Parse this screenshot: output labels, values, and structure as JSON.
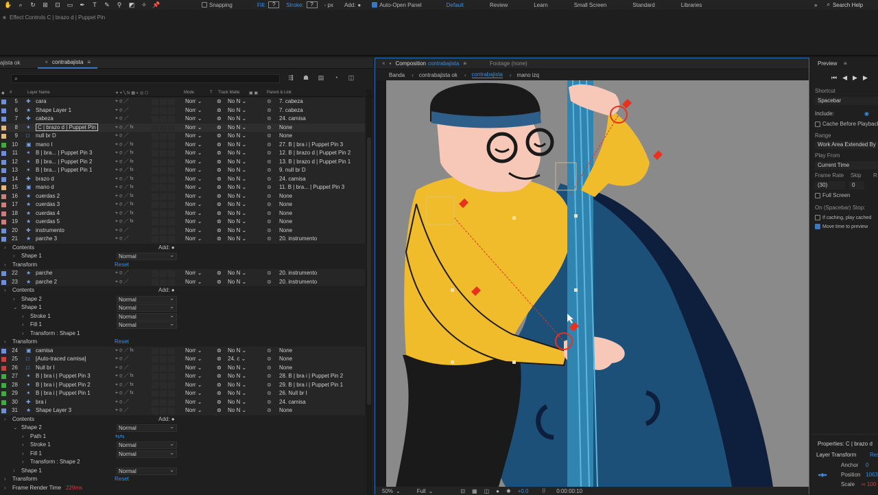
{
  "toolbar": {
    "snapping_label": "Snapping",
    "fill_label": "Fill:",
    "fill_value": "?",
    "stroke_label": "Stroke:",
    "stroke_value": "?",
    "stroke_units": "- px",
    "add_label": "Add:",
    "auto_open_label": "Auto-Open Panel",
    "workspaces": [
      "Default",
      "Review",
      "Learn",
      "Small Screen",
      "Standard",
      "Libraries"
    ],
    "active_workspace": "Default",
    "search_help": "Search Help"
  },
  "effect_controls": {
    "title": "Effect Controls C | brazo d | Puppet Pin"
  },
  "timeline": {
    "tabs": [
      {
        "label": "ajista ok"
      },
      {
        "label": "contrabajista"
      }
    ],
    "columns": {
      "layer_name": "Layer Name",
      "mode": "Mode",
      "t": "T",
      "track_matte": "Track Matte",
      "parent_link": "Parent & Link"
    },
    "rows": [
      {
        "kind": "layer",
        "num": "5",
        "name": "cara",
        "color": "#6f8fd6",
        "icon": "shape",
        "mode": "Norr",
        "tm": "No N",
        "parent": "7. cabeza"
      },
      {
        "kind": "layer",
        "num": "6",
        "name": "Shape Layer 1",
        "color": "#6f8fd6",
        "icon": "star",
        "mode": "Norr",
        "tm": "No N",
        "parent": "7. cabeza"
      },
      {
        "kind": "layer",
        "num": "7",
        "name": "cabeza",
        "color": "#6f8fd6",
        "icon": "shape",
        "mode": "Norr",
        "tm": "No N",
        "parent": "24. camisa"
      },
      {
        "kind": "layer",
        "num": "8",
        "name": "C | brazo d | Puppet Pin",
        "color": "#e0b880",
        "icon": "puppet",
        "mode": "Norr",
        "tm": "No N",
        "parent": "None",
        "selected": true,
        "fx": true
      },
      {
        "kind": "layer",
        "num": "9",
        "name": "null br D",
        "color": "#e0b880",
        "icon": "null",
        "mode": "Norr",
        "tm": "No N",
        "parent": "None"
      },
      {
        "kind": "layer",
        "num": "10",
        "name": "mano I",
        "color": "#44a844",
        "icon": "comp",
        "mode": "Norr",
        "tm": "No N",
        "parent": "27. B | bra i | Puppet Pin 3",
        "fx": true
      },
      {
        "kind": "layer",
        "num": "11",
        "name": "B | bra... | Puppet Pin 3",
        "color": "#6f8fd6",
        "icon": "puppet",
        "mode": "Norr",
        "tm": "No N",
        "parent": "12. B | brazo d | Puppet Pin 2",
        "fx": true
      },
      {
        "kind": "layer",
        "num": "12",
        "name": "B | bra... | Puppet Pin 2",
        "color": "#6f8fd6",
        "icon": "puppet",
        "mode": "Norr",
        "tm": "No N",
        "parent": "13. B | brazo d | Puppet Pin 1",
        "fx": true
      },
      {
        "kind": "layer",
        "num": "13",
        "name": "B | bra... | Puppet Pin 1",
        "color": "#6f8fd6",
        "icon": "puppet",
        "mode": "Norr",
        "tm": "No N",
        "parent": "9. null br D",
        "fx": true
      },
      {
        "kind": "layer",
        "num": "14",
        "name": "brazo d",
        "color": "#6f8fd6",
        "icon": "shape",
        "mode": "Norr",
        "tm": "No N",
        "parent": "24. camisa",
        "fx": true
      },
      {
        "kind": "layer",
        "num": "15",
        "name": "mano d",
        "color": "#e0b880",
        "icon": "comp",
        "mode": "Norr",
        "tm": "No N",
        "parent": "11. B | bra... | Puppet Pin 3",
        "fx": true
      },
      {
        "kind": "layer",
        "num": "16",
        "name": "cuerdas 2",
        "color": "#c88080",
        "icon": "star",
        "mode": "Norr",
        "tm": "No N",
        "parent": "None",
        "fx": true
      },
      {
        "kind": "layer",
        "num": "17",
        "name": "cuerdas 3",
        "color": "#c88080",
        "icon": "star",
        "mode": "Norr",
        "tm": "No N",
        "parent": "None",
        "fx": true
      },
      {
        "kind": "layer",
        "num": "18",
        "name": "cuerdas 4",
        "color": "#c88080",
        "icon": "star",
        "mode": "Norr",
        "tm": "No N",
        "parent": "None",
        "fx": true
      },
      {
        "kind": "layer",
        "num": "19",
        "name": "cuerdas 5",
        "color": "#c88080",
        "icon": "star",
        "mode": "Norr",
        "tm": "No N",
        "parent": "None",
        "fx": true
      },
      {
        "kind": "layer",
        "num": "20",
        "name": "instrumento",
        "color": "#6f8fd6",
        "icon": "shape",
        "mode": "Norr",
        "tm": "No N",
        "parent": "None"
      },
      {
        "kind": "layer",
        "num": "21",
        "name": "parche 3",
        "color": "#6f8fd6",
        "icon": "star",
        "mode": "Norr",
        "tm": "No N",
        "parent": "20. instrumento"
      },
      {
        "kind": "sub",
        "indent": 0,
        "name": "Contents",
        "add": "Add:"
      },
      {
        "kind": "sub",
        "indent": 1,
        "name": "Shape 1",
        "select": "Normal"
      },
      {
        "kind": "sub",
        "indent": 0,
        "name": "Transform",
        "reset": "Reset"
      },
      {
        "kind": "layer",
        "num": "22",
        "name": "parche",
        "color": "#6f8fd6",
        "icon": "star",
        "mode": "Norr",
        "tm": "No N",
        "parent": "20. instrumento"
      },
      {
        "kind": "layer",
        "num": "23",
        "name": "parche 2",
        "color": "#6f8fd6",
        "icon": "star",
        "mode": "Norr",
        "tm": "No N",
        "parent": "20. instrumento"
      },
      {
        "kind": "sub",
        "indent": 0,
        "name": "Contents",
        "add": "Add:"
      },
      {
        "kind": "sub",
        "indent": 1,
        "name": "Shape 2",
        "select": "Normal"
      },
      {
        "kind": "sub",
        "indent": 1,
        "name": "Shape 1",
        "select": "Normal",
        "open": true
      },
      {
        "kind": "sub",
        "indent": 2,
        "name": "Stroke 1",
        "select": "Normal"
      },
      {
        "kind": "sub",
        "indent": 2,
        "name": "Fill 1",
        "select": "Normal"
      },
      {
        "kind": "sub",
        "indent": 2,
        "name": "Transform : Shape 1"
      },
      {
        "kind": "sub",
        "indent": 0,
        "name": "Transform",
        "reset": "Reset"
      },
      {
        "kind": "layer",
        "num": "24",
        "name": "camisa",
        "color": "#6f8fd6",
        "icon": "comp",
        "mode": "Norr",
        "tm": "No N",
        "parent": "None",
        "fx": true
      },
      {
        "kind": "layer",
        "num": "25",
        "name": "[Auto-traced camisa]",
        "color": "#c84040",
        "icon": "null",
        "mode": "Norr",
        "tm": "24. c",
        "parent": "None"
      },
      {
        "kind": "layer",
        "num": "26",
        "name": "Null br I",
        "color": "#c84040",
        "icon": "null",
        "mode": "Norr",
        "tm": "No N",
        "parent": "None"
      },
      {
        "kind": "layer",
        "num": "27",
        "name": "B | bra i | Puppet Pin 3",
        "color": "#44a844",
        "icon": "puppet",
        "mode": "Norr",
        "tm": "No N",
        "parent": "28. B | bra i | Puppet Pin 2",
        "fx": true
      },
      {
        "kind": "layer",
        "num": "28",
        "name": "B | bra i | Puppet Pin 2",
        "color": "#44a844",
        "icon": "puppet",
        "mode": "Norr",
        "tm": "No N",
        "parent": "29. B | bra i | Puppet Pin 1",
        "fx": true
      },
      {
        "kind": "layer",
        "num": "29",
        "name": "B | bra i | Puppet Pin 1",
        "color": "#44a844",
        "icon": "puppet",
        "mode": "Norr",
        "tm": "No N",
        "parent": "26. Null br I",
        "fx": true
      },
      {
        "kind": "layer",
        "num": "30",
        "name": "bra i",
        "color": "#44a844",
        "icon": "shape",
        "mode": "Norr",
        "tm": "No N",
        "parent": "24. camisa"
      },
      {
        "kind": "layer",
        "num": "31",
        "name": "Shape Layer 3",
        "color": "#6f8fd6",
        "icon": "star",
        "mode": "Norr",
        "tm": "No N",
        "parent": "None"
      },
      {
        "kind": "sub",
        "indent": 0,
        "name": "Contents",
        "add": "Add:"
      },
      {
        "kind": "sub",
        "indent": 1,
        "name": "Shape 2",
        "select": "Normal",
        "open": true
      },
      {
        "kind": "sub",
        "indent": 2,
        "name": "Path 1"
      },
      {
        "kind": "sub",
        "indent": 2,
        "name": "Stroke 1",
        "select": "Normal"
      },
      {
        "kind": "sub",
        "indent": 2,
        "name": "Fill 1",
        "select": "Normal"
      },
      {
        "kind": "sub",
        "indent": 2,
        "name": "Transform : Shape 2"
      },
      {
        "kind": "sub",
        "indent": 1,
        "name": "Shape 1",
        "select": "Normal"
      },
      {
        "kind": "sub",
        "indent": 0,
        "name": "Transform",
        "reset": "Reset"
      },
      {
        "kind": "sub",
        "indent": 0,
        "name": "Frame Render Time",
        "value": "229ms"
      }
    ]
  },
  "composition": {
    "tab_label": "Composition",
    "tab_comp": "contrabajista",
    "footage_label": "Footage (none)",
    "breadcrumbs": [
      "Banda",
      "contrabajista ok",
      "contrabajista",
      "mano izq"
    ],
    "active_crumb": "contrabajista",
    "footer": {
      "zoom": "50%",
      "quality": "Full",
      "exposure": "+0.0",
      "time": "0:00:00:10"
    },
    "colors": {
      "bg": "#8a8a8a",
      "sweater": "#f0bc2c",
      "bass": "#1d5078",
      "bass_dark": "#0e1f3e",
      "skin": "#f7c8b8",
      "hat": "#1a1a1a",
      "hatband": "#2e5f8a",
      "pin": "#e8321e"
    }
  },
  "preview": {
    "title": "Preview",
    "shortcut_label": "Shortcut",
    "shortcut_value": "Spacebar",
    "include_label": "Include:",
    "cache_label": "Cache Before Playback",
    "range_label": "Range",
    "range_value": "Work Area Extended By",
    "play_from_label": "Play From",
    "play_from_value": "Current Time",
    "frame_rate_label": "Frame Rate",
    "skip_label": "Skip",
    "r_label": "R",
    "frame_rate_value": "(30)",
    "skip_value": "0",
    "full_screen_label": "Full Screen",
    "stop_label": "On (Spacebar) Stop:",
    "if_caching_label": "If caching, play cached",
    "move_time_label": "Move time to preview",
    "properties_title": "Properties: C | brazo d",
    "layer_transform": "Layer Transform",
    "reset": "Reset",
    "anchor_label": "Anchor",
    "anchor_value": "0",
    "position_label": "Position",
    "position_value": "1063",
    "scale_label": "Scale",
    "scale_value": "∞ 100"
  }
}
